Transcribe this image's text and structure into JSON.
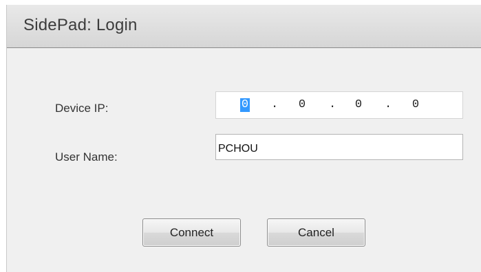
{
  "window": {
    "title": "SidePad: Login"
  },
  "form": {
    "device_ip_label": "Device IP:",
    "device_ip": {
      "octets": [
        "0",
        "0",
        "0",
        "0"
      ],
      "separator": ".",
      "selected_octet_index": 0
    },
    "user_name_label": "User Name:",
    "user_name_value": "PCHOU"
  },
  "buttons": {
    "connect_label": "Connect",
    "cancel_label": "Cancel"
  },
  "colors": {
    "dialog_background": "#f0f0f0",
    "selection": "#3399ff"
  }
}
